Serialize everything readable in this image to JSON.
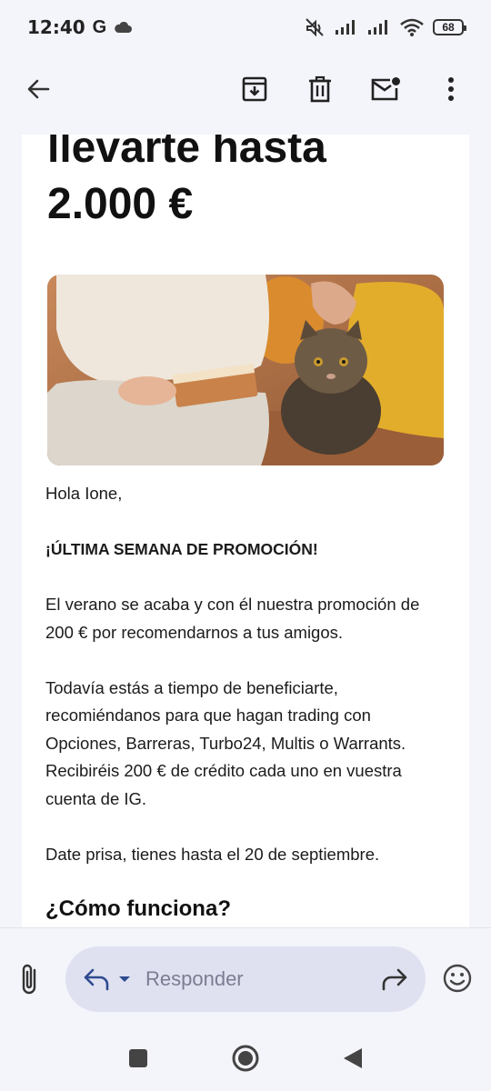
{
  "status": {
    "time": "12:40",
    "carrier_icon": "G",
    "battery": "68"
  },
  "toolbar": {
    "back": "back-arrow-icon",
    "archive": "archive-icon",
    "delete": "trash-icon",
    "mark_unread": "mark-unread-icon",
    "more": "more-vert-icon"
  },
  "email": {
    "headline_line1": "llevarte hasta",
    "headline_line2": "2.000 €",
    "greeting": "Hola Ione,",
    "promo_title": "¡ÚLTIMA SEMANA DE PROMOCIÓN!",
    "paragraph1": "El verano se acaba y con él nuestra promoción de 200 € por recomendarnos a tus amigos.",
    "paragraph2": "Todavía estás a tiempo de beneficiarte, recomiéndanos para que hagan trading con Opciones, Barreras, Turbo24, Multis o Warrants. Recibiréis 200 € de crédito cada uno en vuestra cuenta de IG.",
    "paragraph3": "Date prisa, tienes hasta el 20 de septiembre.",
    "subhead": "¿Cómo funciona?"
  },
  "reply": {
    "placeholder": "Responder"
  },
  "colors": {
    "background": "#f4f4fb",
    "reply_pill": "#dfe1f1",
    "accent": "#3c4a8c"
  }
}
